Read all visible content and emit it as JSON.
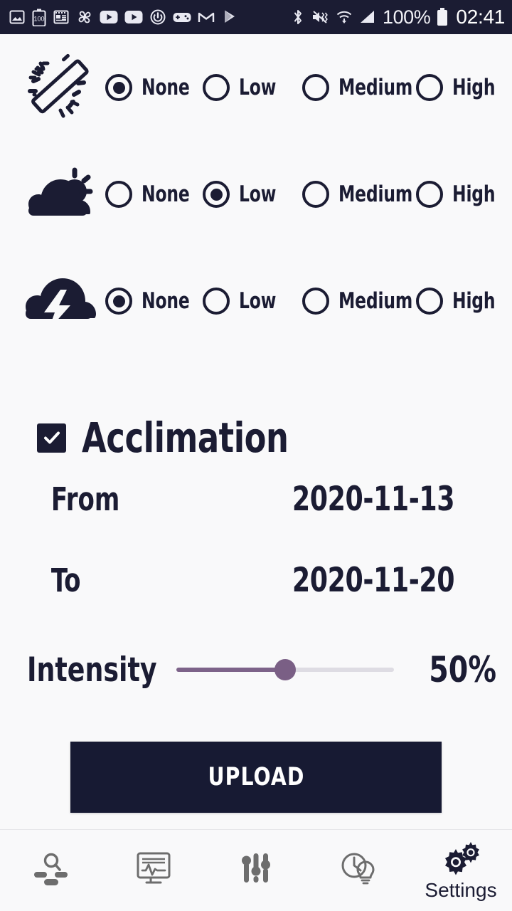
{
  "statusbar": {
    "left_icons": [
      "photo-icon",
      "battery-100-icon",
      "news-icon",
      "fan-icon",
      "youtube-icon",
      "youtube-music-icon",
      "power-icon",
      "game-controller-icon",
      "gmail-icon",
      "play-store-icon"
    ],
    "right_icons": [
      "bluetooth-icon",
      "mute-vibrate-icon",
      "wifi-icon",
      "signal-icon"
    ],
    "battery_percent": "100%",
    "battery_icon": "battery-full-icon",
    "clock": "02:41",
    "background": "#1b1c33",
    "foreground": "#f2f2f7"
  },
  "theme": {
    "background": "#f9f9fa",
    "ink": "#1b1c33",
    "accent": "#7a5f85",
    "track": "#dedce3",
    "nav_inactive": "#6d6d6d"
  },
  "condition_rows": [
    {
      "icon": "fluorescent-tube-light-icon",
      "name": "light",
      "options": [
        {
          "label": "None",
          "selected": true
        },
        {
          "label": "Low",
          "selected": false
        },
        {
          "label": "Medium",
          "selected": false
        },
        {
          "label": "High",
          "selected": false
        }
      ]
    },
    {
      "icon": "partly-cloudy-icon",
      "name": "clouds",
      "options": [
        {
          "label": "None",
          "selected": false
        },
        {
          "label": "Low",
          "selected": true
        },
        {
          "label": "Medium",
          "selected": false
        },
        {
          "label": "High",
          "selected": false
        }
      ]
    },
    {
      "icon": "thunderstorm-icon",
      "name": "storm",
      "options": [
        {
          "label": "None",
          "selected": true
        },
        {
          "label": "Low",
          "selected": false
        },
        {
          "label": "Medium",
          "selected": false
        },
        {
          "label": "High",
          "selected": false
        }
      ]
    }
  ],
  "acclimation": {
    "label": "Acclimation",
    "checked": true,
    "check_icon": "checkmark-icon",
    "from_label": "From",
    "from_value": "2020-11-13",
    "to_label": "To",
    "to_value": "2020-11-20"
  },
  "intensity": {
    "label": "Intensity",
    "value_text": "50%",
    "percent": 50,
    "min": 0,
    "max": 100
  },
  "upload": {
    "label": "UPLOAD"
  },
  "nav": {
    "items": [
      {
        "icon": "plant-scan-icon",
        "label": "",
        "active": false
      },
      {
        "icon": "monitor-chart-icon",
        "label": "",
        "active": false
      },
      {
        "icon": "equalizer-sliders-icon",
        "label": "",
        "active": false
      },
      {
        "icon": "clock-bulb-icon",
        "label": "",
        "active": false
      },
      {
        "icon": "gears-icon",
        "label": "Settings",
        "active": true
      }
    ]
  }
}
